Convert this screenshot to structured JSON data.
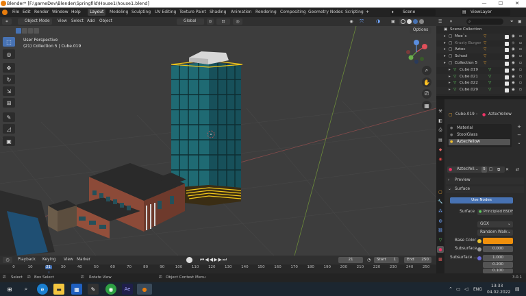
{
  "window": {
    "title": "Blender* [F:\\gameDev\\Blender\\Springfild\\House1\\house1.blend]",
    "minimize": "—",
    "maximize": "☐",
    "close": "✕"
  },
  "menu": {
    "items": [
      "File",
      "Edit",
      "Render",
      "Window",
      "Help"
    ],
    "workspaces": [
      "Layout",
      "Modeling",
      "Sculpting",
      "UV Editing",
      "Texture Paint",
      "Shading",
      "Animation",
      "Rendering",
      "Compositing",
      "Geometry Nodes",
      "Scripting"
    ],
    "active_workspace": "Layout",
    "add_tab": "+",
    "scene": "Scene",
    "view_layer": "ViewLayer"
  },
  "viewport_header": {
    "mode": "Object Mode",
    "menus": [
      "View",
      "Select",
      "Add",
      "Object"
    ],
    "transform_orientation": "Global",
    "options": "Options"
  },
  "viewport": {
    "view_name": "User Perspective",
    "collection_info": "(21) Collection 5 | Cube.019"
  },
  "timeline": {
    "menus": [
      "Playback",
      "Keying",
      "View",
      "Marker"
    ],
    "current_frame": "21",
    "start_label": "Start",
    "start": "1",
    "end_label": "End",
    "end": "250",
    "ticks": [
      "0",
      "10",
      "21",
      "30",
      "40",
      "50",
      "60",
      "70",
      "80",
      "90",
      "100",
      "110",
      "120",
      "130",
      "140",
      "150",
      "160",
      "170",
      "180",
      "190",
      "200",
      "210",
      "220",
      "230",
      "240",
      "250"
    ]
  },
  "statusbar": {
    "select": "Select",
    "box_select": "Box Select",
    "rotate_view": "Rotate View",
    "context_menu": "Object Context Menu",
    "version": "3.0.1"
  },
  "outliner": {
    "search_placeholder": "",
    "rows": [
      {
        "name": "Scene Collection",
        "indent": 0,
        "type": "scene"
      },
      {
        "name": "Moe`s",
        "indent": 1,
        "type": "collection"
      },
      {
        "name": "Krusty Burger",
        "indent": 1,
        "type": "collection"
      },
      {
        "name": "Aztec",
        "indent": 1,
        "type": "collection"
      },
      {
        "name": "School",
        "indent": 1,
        "type": "collection"
      },
      {
        "name": "Collection 5",
        "indent": 1,
        "type": "collection"
      },
      {
        "name": "Cube.019",
        "indent": 2,
        "type": "mesh"
      },
      {
        "name": "Cube.021",
        "indent": 2,
        "type": "mesh"
      },
      {
        "name": "Cube.022",
        "indent": 2,
        "type": "mesh"
      },
      {
        "name": "Cube.029",
        "indent": 2,
        "type": "mesh"
      }
    ]
  },
  "properties": {
    "object_name": "Cube.019",
    "material_name": "AztecYellow",
    "slots": [
      "Material",
      "StoolGlass",
      "AztecYellow"
    ],
    "selected_slot": "AztecYellow",
    "datablock": "AztecYell...",
    "user_count": "5",
    "preview": "Preview",
    "surface_section": "Surface",
    "use_nodes": "Use Nodes",
    "surface_label": "Surface",
    "surface_shader": "Principled BSDF",
    "distribution": "GGX",
    "subsurface_method": "Random Walk",
    "base_color_label": "Base Color",
    "base_color": "#f0900c",
    "subsurface_label": "Subsurface",
    "subsurface_value": "0.000",
    "subsurface_radius_label": "Subsurface ...",
    "subsurface_radius": [
      "1.000",
      "0.200",
      "0.100"
    ]
  },
  "taskbar": {
    "language": "ENG",
    "time": "13:33",
    "date": "04.02.2022"
  },
  "colors": {
    "accent": "#4772b3",
    "orange": "#f0900c",
    "selection": "#334d80"
  }
}
